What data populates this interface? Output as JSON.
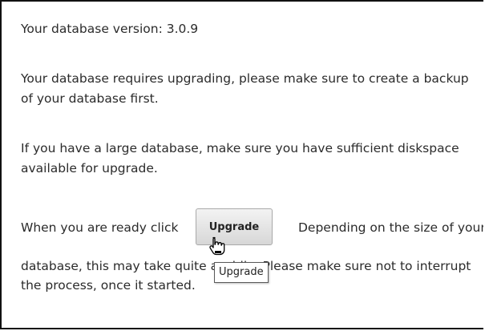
{
  "upgrade_page": {
    "version_text": "Your database version: 3.0.9",
    "requires_line1": "Your database requires upgrading, please make sure to create a backup",
    "requires_line2": "of your database first.",
    "large_line1": "If you have a large database, make sure you have sufficient diskspace",
    "large_line2": "available for upgrade.",
    "ready_prefix": "When you are ready click",
    "ready_suffix": "Depending on the size of your",
    "time_line1": "database, this may take quite a while. Please make sure not to interrupt",
    "time_line2": "the process, once it started.",
    "upgrade_button_label": "Upgrade",
    "tooltip_text": "Upgrade"
  },
  "icons": {
    "cursor": "hand-pointer-icon"
  }
}
